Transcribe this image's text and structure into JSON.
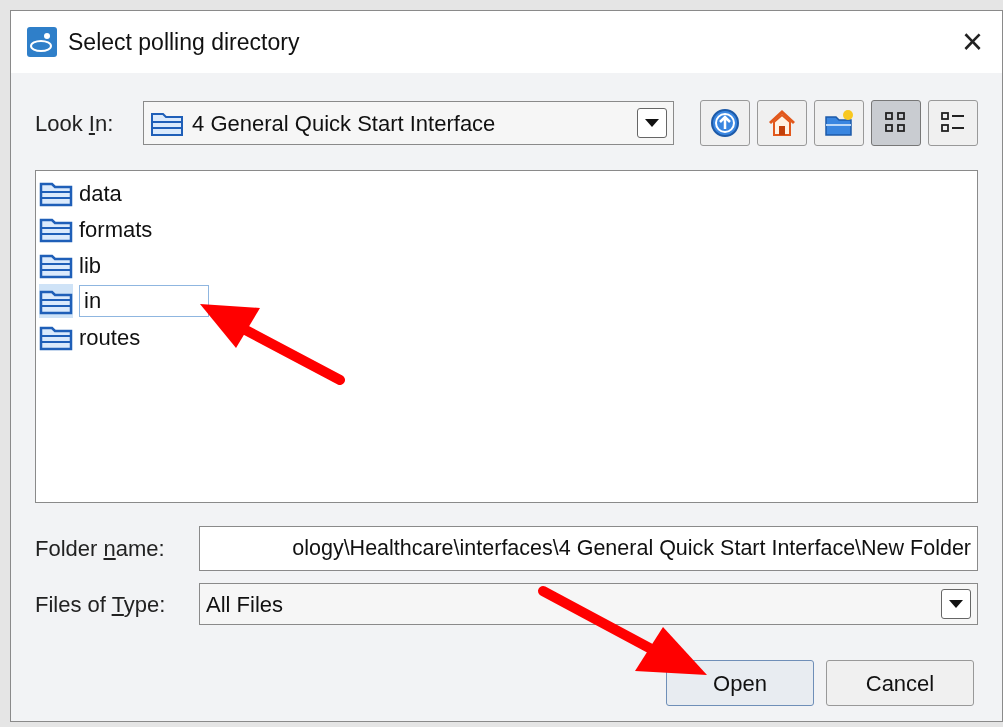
{
  "window": {
    "title": "Select polling directory",
    "close": "×"
  },
  "look_in": {
    "label": {
      "before": "Look ",
      "key": "I",
      "after": "n:"
    },
    "value": "4 General Quick Start Interface"
  },
  "toolbar": [
    {
      "kind": "up",
      "selected": false
    },
    {
      "kind": "home",
      "selected": false
    },
    {
      "kind": "new-folder",
      "selected": false
    },
    {
      "kind": "list",
      "selected": true
    },
    {
      "kind": "details",
      "selected": false
    }
  ],
  "files": [
    {
      "name": "data",
      "selected": false,
      "editing": false
    },
    {
      "name": "formats",
      "selected": false,
      "editing": false
    },
    {
      "name": "lib",
      "selected": false,
      "editing": false
    },
    {
      "name": "in",
      "selected": true,
      "editing": true
    },
    {
      "name": "routes",
      "selected": false,
      "editing": false
    }
  ],
  "folder_name": {
    "label": {
      "before": "Folder ",
      "key": "n",
      "after": "ame:"
    },
    "value": "ology\\Healthcare\\interfaces\\4 General Quick Start Interface\\New Folder"
  },
  "files_of_type": {
    "label": {
      "before": "Files of ",
      "key": "T",
      "after": "ype:"
    },
    "value": "All Files"
  },
  "buttons": [
    {
      "label": "Open",
      "default": true
    },
    {
      "label": "Cancel",
      "default": false
    }
  ]
}
